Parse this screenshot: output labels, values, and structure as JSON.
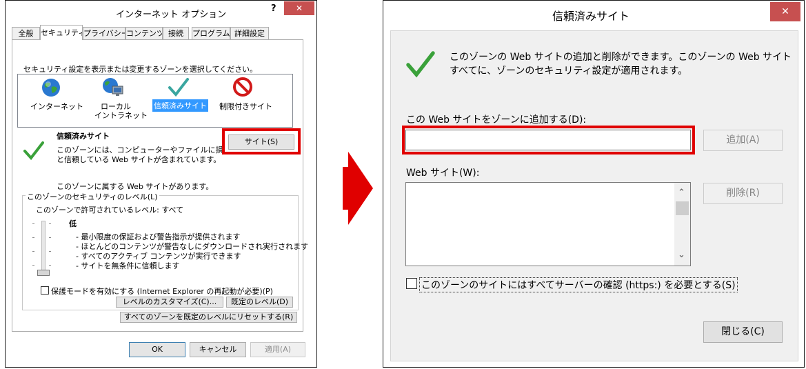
{
  "left": {
    "title": "インターネット オプション",
    "help": "?",
    "close": "✕",
    "tabs": [
      "全般",
      "セキュリティ",
      "プライバシー",
      "コンテンツ",
      "接続",
      "プログラム",
      "詳細設定"
    ],
    "instruction": "セキュリティ設定を表示または変更するゾーンを選択してください。",
    "zones": [
      "インターネット",
      "ローカル",
      "イントラネット",
      "信頼済みサイト",
      "制限付きサイト"
    ],
    "zone_heading": "信頼済みサイト",
    "zone_desc_1": "このゾーンには、コンピューターやファイルに損害を与えない",
    "zone_desc_2": "と信頼している Web サイトが含まれています。",
    "sites_button": "サイト(S)",
    "has_sites": "このゾーンに属する Web サイトがあります。",
    "group_label": "このゾーンのセキュリティのレベル(L)",
    "allowed_levels": "このゾーンで許可されているレベル: すべて",
    "level_name": "低",
    "level_items": [
      "- 最小限度の保証および警告指示が提供されます",
      "- ほとんどのコンテンツが警告なしにダウンロードされ実行されます",
      "- すべてのアクティブ コンテンツが実行できます",
      "- サイトを無条件に信頼します"
    ],
    "protected_mode": "保護モードを有効にする (Internet Explorer の再起動が必要)(P)",
    "custom_level": "レベルのカスタマイズ(C)...",
    "default_level": "既定のレベル(D)",
    "reset_all": "すべてのゾーンを既定のレベルにリセットする(R)",
    "ok": "OK",
    "cancel": "キャンセル",
    "apply": "適用(A)"
  },
  "right": {
    "title": "信頼済みサイト",
    "close": "✕",
    "info_1": "このゾーンの Web サイトの追加と削除ができます。このゾーンの Web サイト",
    "info_2": "すべてに、ゾーンのセキュリティ設定が適用されます。",
    "add_label": "この Web サイトをゾーンに追加する(D):",
    "add_value": "",
    "add_button": "追加(A)",
    "websites_label": "Web サイト(W):",
    "remove_button": "削除(R)",
    "https_check": "このゾーンのサイトにはすべてサーバーの確認 (https:) を必要とする(S)",
    "close_button": "閉じる(C)",
    "scroll_up": "⌃",
    "scroll_down": "⌄"
  },
  "colors": {
    "highlight_red": "#e00000",
    "check_green": "#3aa13a",
    "selection_blue": "#3399ff"
  }
}
